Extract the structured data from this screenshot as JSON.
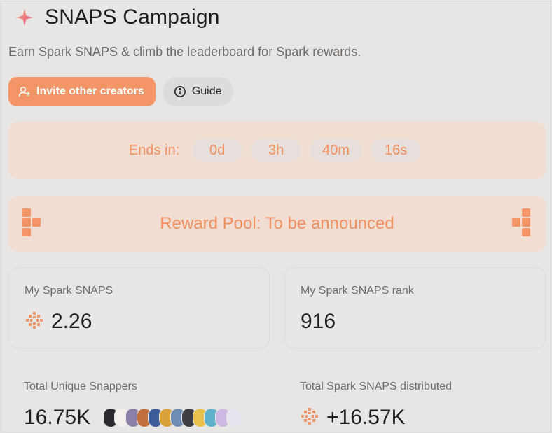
{
  "header": {
    "title": "SNAPS Campaign",
    "subtitle": "Earn Spark SNAPS & climb the leaderboard for Spark rewards."
  },
  "actions": {
    "invite_label": "Invite other creators",
    "guide_label": "Guide"
  },
  "countdown": {
    "label": "Ends in:",
    "days": "0d",
    "hours": "3h",
    "minutes": "40m",
    "seconds": "16s"
  },
  "reward_pool": {
    "text": "Reward Pool: To be announced"
  },
  "stats": {
    "my_snaps_label": "My Spark SNAPS",
    "my_snaps_value": "2.26",
    "my_rank_label": "My Spark SNAPS rank",
    "my_rank_value": "916",
    "unique_snappers_label": "Total Unique Snappers",
    "unique_snappers_value": "16.75K",
    "distributed_label": "Total Spark SNAPS distributed",
    "distributed_value": "+16.57K"
  },
  "colors": {
    "accent": "#f39567",
    "accent_text": "#f0915f",
    "panel_tint": "#f2ddd2"
  },
  "icons": [
    "spark-logo-icon",
    "add-user-icon",
    "info-icon",
    "snaps-spark-icon"
  ]
}
